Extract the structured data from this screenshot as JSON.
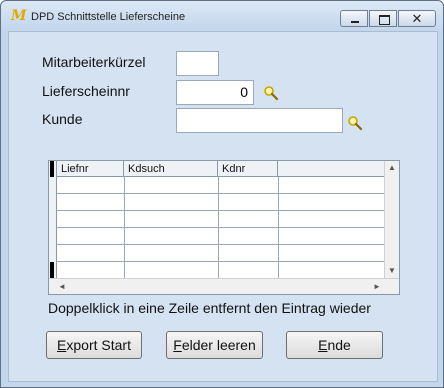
{
  "window": {
    "title": "DPD Schnittstelle Lieferscheine",
    "logo_glyph": "M",
    "controls": {
      "minimize": "minimize-icon",
      "maximize": "maximize-icon",
      "close": "close-icon"
    }
  },
  "form": {
    "mitarbeiter": {
      "label": "Mitarbeiterkürzel",
      "value": ""
    },
    "lieferschein": {
      "label": "Lieferscheinnr",
      "value": "0"
    },
    "kunde": {
      "label": "Kunde",
      "value": ""
    }
  },
  "grid": {
    "columns": [
      "Liefnr",
      "Kdsuch",
      "Kdnr",
      ""
    ],
    "rows": [
      [
        "",
        "",
        "",
        ""
      ],
      [
        "",
        "",
        "",
        ""
      ],
      [
        "",
        "",
        "",
        ""
      ],
      [
        "",
        "",
        "",
        ""
      ],
      [
        "",
        "",
        "",
        ""
      ],
      [
        "",
        "",
        "",
        ""
      ]
    ],
    "scroll_up": "▲",
    "scroll_down": "▼",
    "scroll_left": "◄",
    "scroll_right": "►"
  },
  "hint": "Doppelklick in eine Zeile entfernt den Eintrag wieder",
  "buttons": {
    "export": {
      "pre": "",
      "accel": "E",
      "post": "xport Start"
    },
    "clear": {
      "pre": "",
      "accel": "F",
      "post": "elder leeren"
    },
    "end": {
      "pre": "",
      "accel": "E",
      "post": "nde"
    }
  },
  "colors": {
    "accent": "#e2a800",
    "search_icon": "#d7b800"
  }
}
